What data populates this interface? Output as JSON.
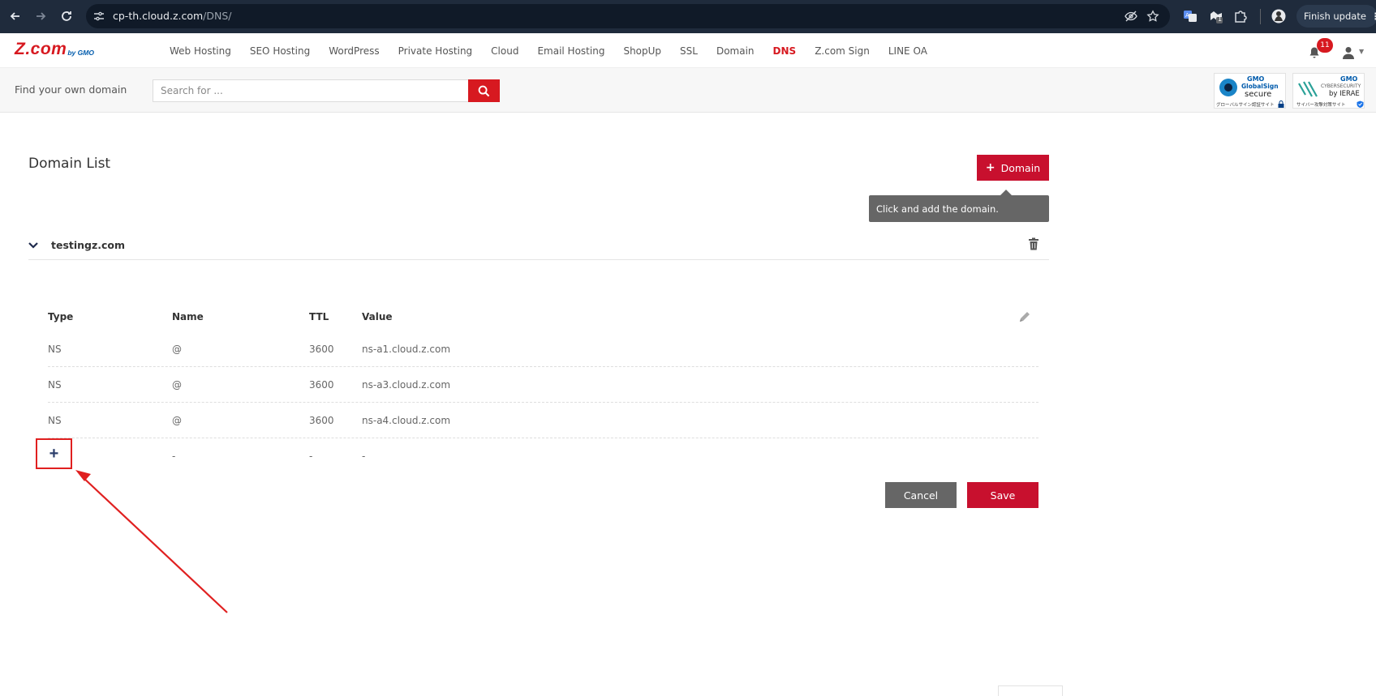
{
  "browser": {
    "url_host": "cp-th.cloud.z.com",
    "url_path": "/DNS/",
    "finish_update_label": "Finish update",
    "extension_badge": "1"
  },
  "header": {
    "logo_main": "Z.com",
    "logo_sub": "by GMO",
    "nav_items": [
      {
        "label": "Web Hosting"
      },
      {
        "label": "SEO Hosting"
      },
      {
        "label": "WordPress"
      },
      {
        "label": "Private Hosting"
      },
      {
        "label": "Cloud"
      },
      {
        "label": "Email Hosting"
      },
      {
        "label": "ShopUp"
      },
      {
        "label": "SSL"
      },
      {
        "label": "Domain"
      },
      {
        "label": "DNS"
      },
      {
        "label": "Z.com Sign"
      },
      {
        "label": "LINE OA"
      }
    ],
    "active_nav": "DNS",
    "notification_count": "11"
  },
  "search": {
    "label": "Find your own domain",
    "placeholder": "Search for ..."
  },
  "badges": {
    "globalsign": {
      "t1": "GMO",
      "t2": "GlobalSign",
      "t3": "secure",
      "t4": "グローバルサイン認証サイト"
    },
    "cybersecurity": {
      "t1": "GMO",
      "t2": "CYBERSECURITY",
      "t3": "by IERAE",
      "t4": "サイバー攻撃対策サイト"
    }
  },
  "main": {
    "title": "Domain List",
    "add_domain_label": "Domain",
    "tooltip": "Click and add the domain.",
    "domain": "testingz.com",
    "columns": {
      "type": "Type",
      "name": "Name",
      "ttl": "TTL",
      "value": "Value"
    },
    "records": [
      {
        "type": "NS",
        "name": "@",
        "ttl": "3600",
        "value": "ns-a1.cloud.z.com"
      },
      {
        "type": "NS",
        "name": "@",
        "ttl": "3600",
        "value": "ns-a3.cloud.z.com"
      },
      {
        "type": "NS",
        "name": "@",
        "ttl": "3600",
        "value": "ns-a4.cloud.z.com"
      }
    ],
    "new_record": {
      "name": "-",
      "ttl": "-",
      "value": "-"
    },
    "cancel_label": "Cancel",
    "save_label": "Save"
  },
  "colors": {
    "brand_red": "#c8102e",
    "annotation_red": "#e02020",
    "chrome_bg": "#1f2b3c"
  }
}
